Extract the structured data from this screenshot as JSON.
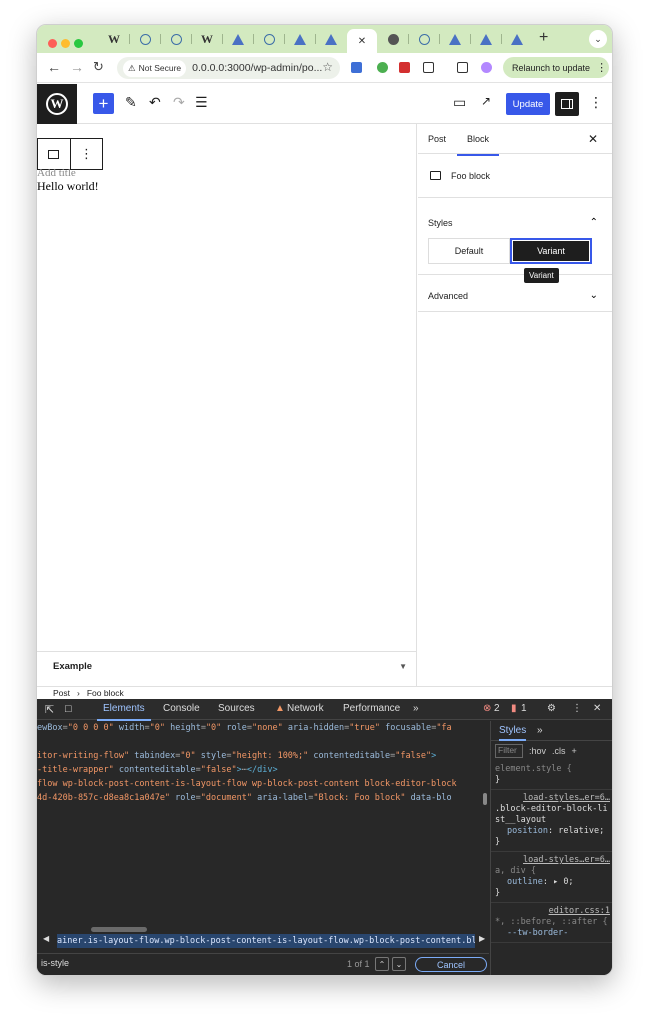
{
  "browser": {
    "tab_favicons": [
      "W",
      "wp",
      "wp",
      "W",
      "a",
      "wp",
      "a",
      "a",
      "active",
      "gh",
      "wp",
      "a",
      "a",
      "a"
    ],
    "new_tab_label": "+",
    "security_label": "Not Secure",
    "url": "0.0.0.0:3000/wp-admin/po...",
    "relaunch_label": "Relaunch to update"
  },
  "wp": {
    "update_label": "Update",
    "canvas": {
      "title_placeholder": "Add title",
      "content": "Hello world!"
    },
    "meta_box": "Example",
    "sidebar": {
      "tabs": [
        "Post",
        "Block"
      ],
      "selected_tab": "Block",
      "block_name": "Foo block",
      "styles_heading": "Styles",
      "style_options": [
        "Default",
        "Variant"
      ],
      "selected_style": "Variant",
      "tooltip": "Variant",
      "advanced_heading": "Advanced"
    },
    "breadcrumb": [
      "Post",
      "Foo block"
    ],
    "breadcrumb_sep": "›"
  },
  "devtools": {
    "tabs": [
      "Elements",
      "Console",
      "Sources",
      "Network",
      "Performance"
    ],
    "more": "»",
    "errors": "2",
    "warnings": "1",
    "code_lines": [
      {
        "segs": [
          [
            "an",
            "ewBox"
          ],
          [
            "eq",
            "="
          ],
          [
            "av",
            "\"0 0 0 0\""
          ],
          [
            "an",
            " width"
          ],
          [
            "eq",
            "="
          ],
          [
            "av",
            "\"0\""
          ],
          [
            "an",
            " height"
          ],
          [
            "eq",
            "="
          ],
          [
            "av",
            "\"0\""
          ],
          [
            "an",
            " role"
          ],
          [
            "eq",
            "="
          ],
          [
            "av",
            "\"none\""
          ],
          [
            "an",
            " aria-hidden"
          ],
          [
            "eq",
            "="
          ],
          [
            "av",
            "\"true\""
          ],
          [
            "an",
            " focusable"
          ],
          [
            "eq",
            "="
          ],
          [
            "av",
            "\"fa"
          ]
        ]
      },
      {
        "segs": [
          [
            "eq",
            ""
          ]
        ]
      },
      {
        "segs": [
          [
            "av",
            "itor-writing-flow\""
          ],
          [
            "an",
            " tabindex"
          ],
          [
            "eq",
            "="
          ],
          [
            "av",
            "\"0\""
          ],
          [
            "an",
            " style"
          ],
          [
            "eq",
            "="
          ],
          [
            "av",
            "\"height: 100%;\""
          ],
          [
            "an",
            " contenteditable"
          ],
          [
            "eq",
            "="
          ],
          [
            "av",
            "\"false\""
          ],
          [
            "tg",
            ">"
          ]
        ]
      },
      {
        "segs": [
          [
            "av",
            "-title-wrapper\""
          ],
          [
            "an",
            " contenteditable"
          ],
          [
            "eq",
            "="
          ],
          [
            "av",
            "\"false\""
          ],
          [
            "tg",
            ">"
          ],
          [
            "eq",
            "⋯"
          ],
          [
            "tg",
            "</div>"
          ]
        ]
      },
      {
        "segs": [
          [
            "av",
            "flow wp-block-post-content-is-layout-flow wp-block-post-content block-editor-block"
          ]
        ]
      },
      {
        "segs": [
          [
            "av",
            "4d-420b-857c-d8ea8c1a047e\""
          ],
          [
            "an",
            " role"
          ],
          [
            "eq",
            "="
          ],
          [
            "av",
            "\"document\""
          ],
          [
            "an",
            " aria-label"
          ],
          [
            "eq",
            "="
          ],
          [
            "av",
            "\"Block: Foo block\""
          ],
          [
            "an",
            " data-blo"
          ]
        ]
      }
    ],
    "selected_path": "ainer.is-layout-flow.wp-block-post-content-is-layout-flow.wp-block-post-content.block-editor-",
    "search_value": "is-style",
    "search_count": "1 of 1",
    "cancel_label": "Cancel",
    "styles": {
      "tab": "Styles",
      "filter_placeholder": "Filter",
      "hov": ":hov",
      "cls": ".cls",
      "element_style": "element.style {",
      "close_brace": "}",
      "rule1_src": "load-styles…er=6…",
      "rule1_sel": ".block-editor-block-list__layout",
      "rule1_prop": "position",
      "rule1_val": "relative;",
      "rule2_src": "load-styles…er=6…",
      "rule2_sel": "a, div {",
      "rule2_prop": "outline",
      "rule2_val": "▸ 0;",
      "rule3_src": "editor.css:1",
      "rule3_sel": "*, ::before, ::after {",
      "rule3_prop": "--tw-border-"
    }
  },
  "colors": {
    "tabstrip": "#d3eac0",
    "wp_blue": "#3858e9",
    "wp_dark": "#1e1e1e",
    "devtools_bg": "#282828",
    "devtools_accent": "#7cacf8"
  }
}
